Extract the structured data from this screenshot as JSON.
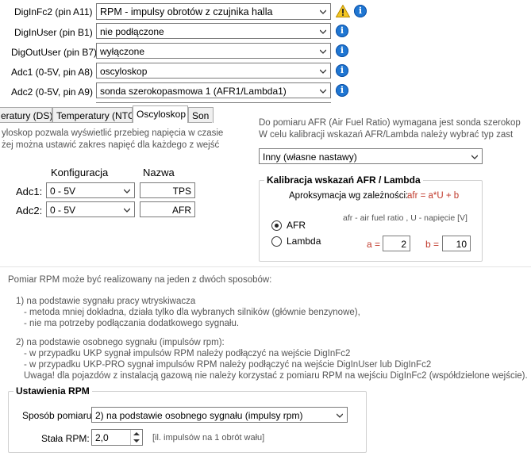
{
  "top_pins": [
    {
      "label": "DigInFc2 (pin A11) :",
      "value": "RPM - impulsy obrotów z czujnika halla",
      "warning": true
    },
    {
      "label": "DigInUser (pin B1) :",
      "value": "nie podłączone",
      "warning": false
    },
    {
      "label": "DigOutUser (pin B7) :",
      "value": "wyłączone",
      "warning": false
    },
    {
      "label": "Adc1 (0-5V, pin A8) :",
      "value": "oscyloskop",
      "warning": false
    },
    {
      "label": "Adc2 (0-5V, pin A9) :",
      "value": "sonda szerokopasmowa 1 (AFR1/Lambda1)",
      "warning": false
    }
  ],
  "tabs": {
    "items": [
      "eratury (DS)",
      "Temperatury (NTC)",
      "Oscyloskop",
      "Son"
    ],
    "active": 2
  },
  "osc": {
    "desc_line1": "yloskop pozwala wyświetlić przebieg napięcia w czasie",
    "desc_line2": "żej można ustawić zakres napięć dla każdego z wejść",
    "col_config": "Konfiguracja",
    "col_name": "Nazwa",
    "rows": [
      {
        "label": "Adc1:",
        "range": "0 - 5V",
        "name": "TPS"
      },
      {
        "label": "Adc2:",
        "range": "0 - 5V",
        "name": "AFR"
      }
    ]
  },
  "afr": {
    "desc_line1": "Do pomiaru AFR (Air Fuel Ratio) wymagana jest sonda szerokop",
    "desc_line2": "W celu kalibracji wskazań AFR/Lambda należy wybrać typ zast",
    "sensor_type": "Inny  (własne nastawy)",
    "group_title": "Kalibracja wskazań AFR / Lambda",
    "approx_label": "Aproksymacja wg zależności:",
    "approx_formula": "afr = a*U + b",
    "legend": "afr - air fuel ratio , U - napięcie [V]",
    "radio_afr": "AFR",
    "radio_lambda": "Lambda",
    "selected": "AFR",
    "a_label": "a =",
    "a_value": "2",
    "b_label": "b =",
    "b_value": "10",
    "formula_color": "#c0392b"
  },
  "rpm": {
    "intro": "Pomiar RPM może być realizowany na jeden z dwóch sposobów:",
    "m1_title": "1) na podstawie sygnału pracy wtryskiwacza",
    "m1_l1": "- metoda mniej dokładna, działa tylko dla wybranych silników (głównie benzynowe),",
    "m1_l2": "- nie ma potrzeby podłączania dodatkowego sygnału.",
    "m2_title": "2) na podstawie osobnego sygnału (impulsów rpm):",
    "m2_l1": "- w przypadku UKP sygnał impulsów RPM należy podłączyć na wejście DigInFc2",
    "m2_l2": "- w przypadku UKP-PRO sygnał impulsów RPM należy podłączyć na wejście DigInUser lub DigInFc2",
    "m2_l3": "Uwaga! dla pojazdów z instalacją gazową nie należy korzystać z pomiaru RPM na wejściu DigInFc2 (współdzielone wejście).",
    "group_title": "Ustawienia RPM",
    "method_label": "Sposób pomiaru:",
    "method_value": "2) na podstawie osobnego sygnału (impulsy rpm)",
    "const_label": "Stała RPM:",
    "const_value": "2,0",
    "const_hint": "[il. impulsów na 1 obrót wału]"
  }
}
